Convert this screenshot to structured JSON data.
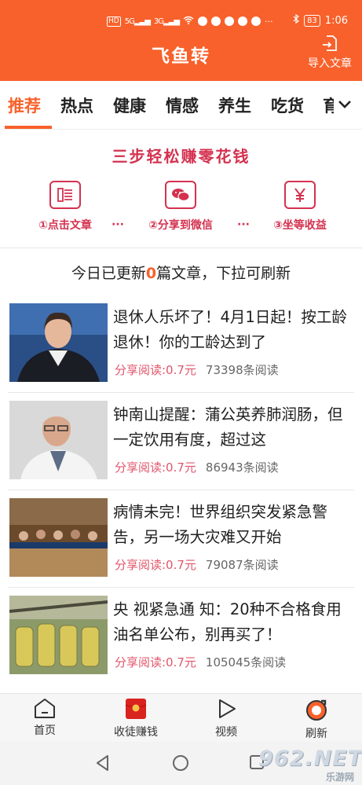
{
  "status_bar": {
    "left_icons": [
      "hd-icon",
      "signal-5g-icon",
      "signal-3g-icon",
      "wifi-icon",
      "app-icon",
      "chat-icon",
      "wechat-icon",
      "chat-icon",
      "app-icon",
      "more-icon"
    ],
    "hd": "HD",
    "sig1": "5G",
    "sig2": "3G",
    "more": "···",
    "battery": "83",
    "time": "1:06"
  },
  "header": {
    "title": "飞鱼转",
    "import_label": "导入文章",
    "bg_color": "#f8612b"
  },
  "tabs": [
    {
      "label": "推荐",
      "active": true
    },
    {
      "label": "热点",
      "active": false
    },
    {
      "label": "健康",
      "active": false
    },
    {
      "label": "情感",
      "active": false
    },
    {
      "label": "养生",
      "active": false
    },
    {
      "label": "吃货",
      "active": false
    },
    {
      "label": "育",
      "active": false
    }
  ],
  "steps_banner": {
    "title": "三步轻松赚零花钱",
    "steps": [
      {
        "label": "①点击文章",
        "icon": "article-icon"
      },
      {
        "label": "②分享到微信",
        "icon": "wechat-icon"
      },
      {
        "label": "③坐等收益",
        "icon": "yuan-icon"
      }
    ],
    "dots": "···",
    "accent_color": "#d4314f"
  },
  "notice": {
    "prefix": "今日已更新",
    "count": "0",
    "suffix": "篇文章，下拉可刷新"
  },
  "articles": [
    {
      "title": "退休人乐坏了！4月1日起！按工龄退休！你的工龄达到了",
      "earn": "分享阅读:0.7元",
      "reads": "73398条阅读"
    },
    {
      "title": "钟南山提醒：蒲公英养肺润肠，但一定饮用有度，超过这",
      "earn": "分享阅读:0.7元",
      "reads": "86943条阅读"
    },
    {
      "title": "病情未完！世界组织突发紧急警告，另一场大灾难又开始",
      "earn": "分享阅读:0.7元",
      "reads": "79087条阅读"
    },
    {
      "title": "央 视紧急通 知：20种不合格食用油名单公布，别再买了！",
      "earn": "分享阅读:0.7元",
      "reads": "105045条阅读"
    }
  ],
  "bottom_nav": [
    {
      "label": "首页",
      "icon": "home-icon"
    },
    {
      "label": "收徒赚钱",
      "icon": "red-envelope-icon"
    },
    {
      "label": "视频",
      "icon": "play-icon"
    },
    {
      "label": "刷新",
      "icon": "refresh-icon"
    }
  ],
  "watermark": {
    "big": "962.NET",
    "small": "乐游网"
  }
}
